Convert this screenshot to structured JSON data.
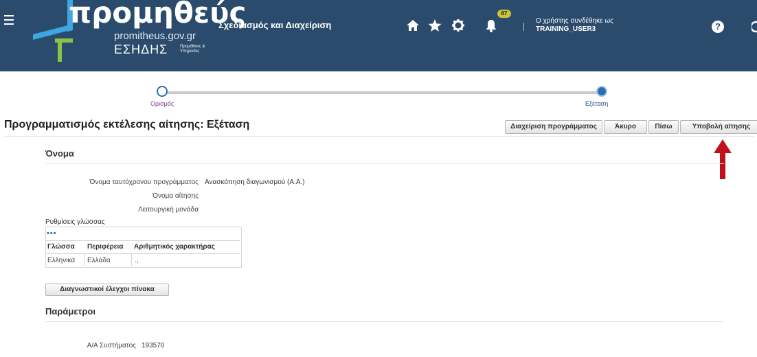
{
  "header": {
    "logo_word": "προμηθεύς",
    "logo_domain": "promitheus.gov.gr",
    "logo_esidis": "ΕΣΗΔΗΣ",
    "logo_esidis_sub": "Προμήθειες & Υπηρεσίες",
    "app_title": "Σχεδιασμός και Διαχείριση",
    "notifications_count": "87",
    "user_line1": "Ο χρήστης συνδέθηκε ως",
    "user_line2": "TRAINING_USER3",
    "help": "?"
  },
  "train": {
    "step1": "Ορισμός",
    "step2": "Εξέταση"
  },
  "page": {
    "title": "Προγραμματισμός εκτέλεσης αίτησης: Εξέταση"
  },
  "buttons": {
    "manage_schedule": "Διαχείριση προγράμματος",
    "cancel": "Άκυρο",
    "back": "Πίσω",
    "submit": "Υποβολή αίτησης",
    "diagnostics": "Διαγνωστικοί έλεγχοι πίνακα"
  },
  "name_section": {
    "title": "Όνομα",
    "label_program": "Όνομα ταυτόχρονου προγράμματος",
    "value_program": "Ανασκόπηση διαγωνισμού (Α.Α.)",
    "label_request": "Όνομα αίτησης",
    "label_unit": "Λειτουργική μονάδα"
  },
  "language": {
    "title": "Ρυθμίσεις γλώσσας",
    "dots": "•••",
    "columns": [
      "Γλώσσα",
      "Περιφέρεια",
      "Αριθμητικός χαρακτήρας"
    ],
    "row": [
      "Ελληνικά",
      "Ελλάδα",
      ".,"
    ]
  },
  "params_section": {
    "title": "Παράμετροι",
    "label_system": "Α/Α Συστήματος",
    "value_system": "193570"
  }
}
